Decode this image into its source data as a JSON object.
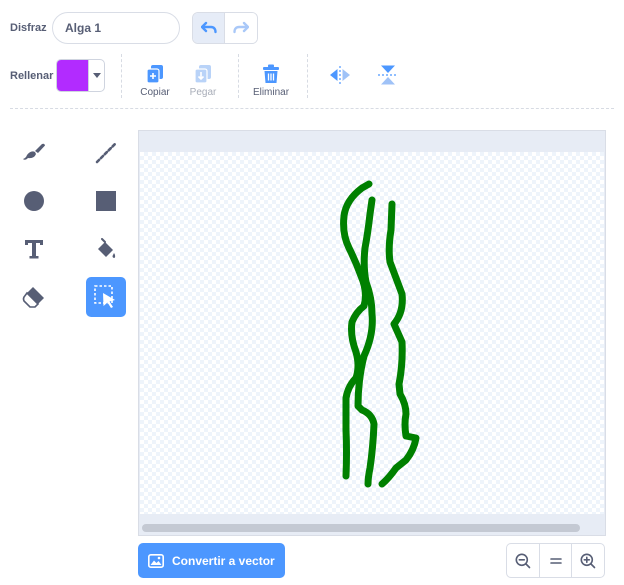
{
  "costume": {
    "label": "Disfraz",
    "name_value": "Alga 1"
  },
  "history": {
    "undo_icon": "undo-icon",
    "redo_icon": "redo-icon"
  },
  "fill": {
    "label": "Rellenar",
    "color": "#b22bff"
  },
  "actions": {
    "copy_label": "Copiar",
    "paste_label": "Pegar",
    "delete_label": "Eliminar",
    "flip_h_icon": "flip-horizontal-icon",
    "flip_v_icon": "flip-vertical-icon"
  },
  "tools": [
    {
      "name": "brush",
      "icon": "brush-icon"
    },
    {
      "name": "line",
      "icon": "line-icon"
    },
    {
      "name": "circle",
      "icon": "circle-icon"
    },
    {
      "name": "rectangle",
      "icon": "rectangle-icon"
    },
    {
      "name": "text",
      "icon": "text-icon"
    },
    {
      "name": "fill",
      "icon": "fill-bucket-icon"
    },
    {
      "name": "eraser",
      "icon": "eraser-icon"
    },
    {
      "name": "select",
      "icon": "select-icon",
      "active": true
    }
  ],
  "canvas": {
    "stroke_color": "#008000"
  },
  "bottom": {
    "convert_label": "Convertir a vector",
    "zoom_out_icon": "zoom-out-icon",
    "zoom_reset_icon": "zoom-reset-icon",
    "zoom_in_icon": "zoom-in-icon"
  },
  "colors": {
    "accent": "#4c97ff",
    "text": "#575e75"
  }
}
